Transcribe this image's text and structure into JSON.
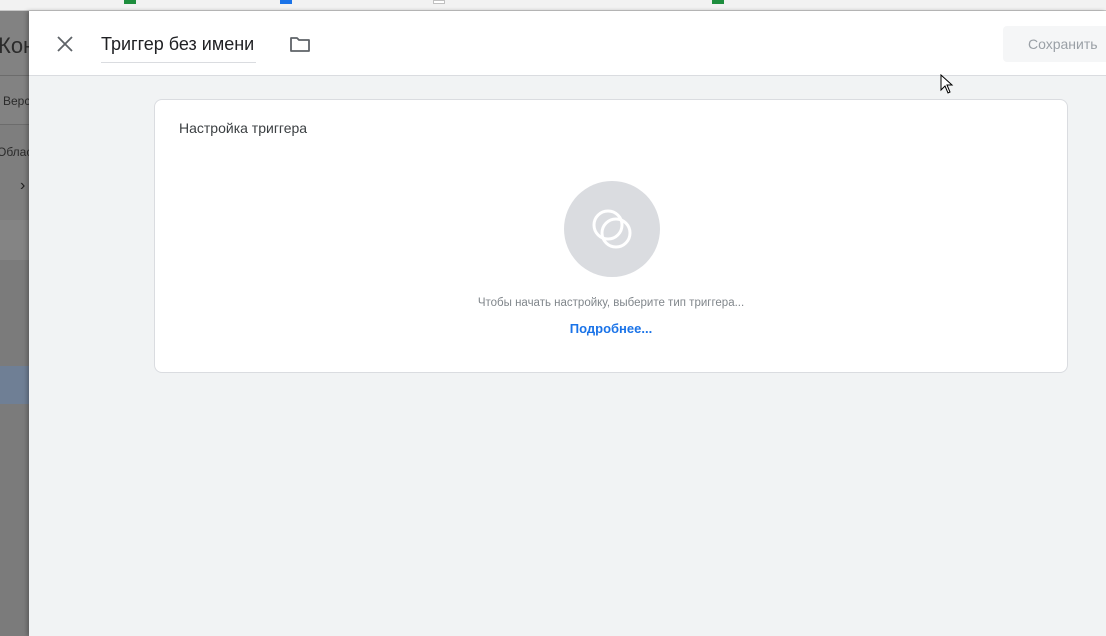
{
  "backdrop": {
    "title": "Контейнер",
    "nav_text": "Версии",
    "area_text": "Область"
  },
  "panel": {
    "title": "Триггер без имени",
    "save_label": "Сохранить"
  },
  "card": {
    "title": "Настройка триггера",
    "hint": "Чтобы начать настройку, выберите тип триггера...",
    "learn_more": "Подробнее..."
  },
  "icons": {
    "close": "close-icon",
    "folder": "folder-icon",
    "trigger": "trigger-type-icon",
    "cursor": "mouse-cursor-icon"
  },
  "colors": {
    "link": "#1a73e8",
    "header_bg": "#ffffff",
    "panel_bg": "#f1f3f4",
    "picker_bg": "#dadce0"
  }
}
